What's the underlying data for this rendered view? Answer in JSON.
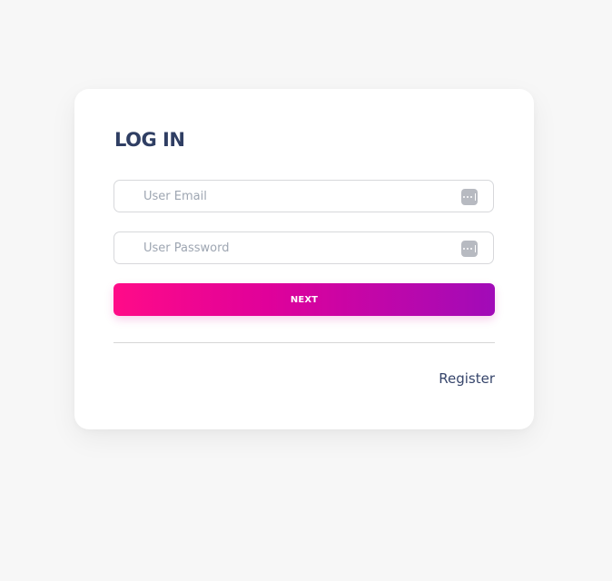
{
  "login": {
    "title": "LOG IN",
    "email": {
      "placeholder": "User Email",
      "value": "",
      "icon": "password-manager-icon"
    },
    "password": {
      "placeholder": "User Password",
      "value": "",
      "icon": "password-manager-icon"
    },
    "next_label": "NEXT",
    "register_label": "Register"
  },
  "colors": {
    "background": "#f7f7f7",
    "card": "#ffffff",
    "title": "#2f3e63",
    "button_gradient_start": "#ff0b88",
    "button_gradient_end": "#a10bb8",
    "link": "#36456b"
  }
}
